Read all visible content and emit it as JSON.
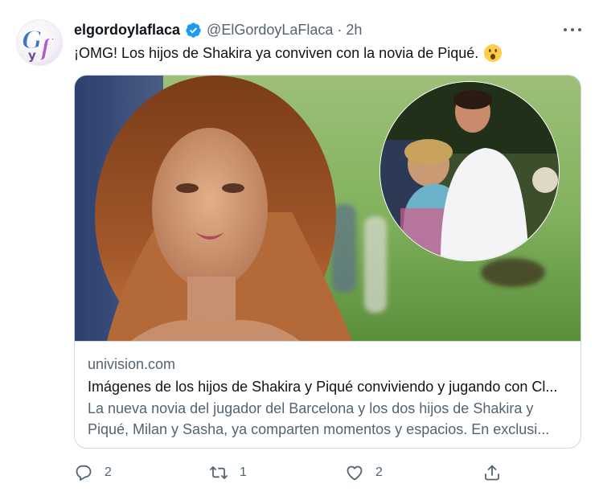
{
  "author": {
    "name": "elgordoylaflaca",
    "handle": "@ElGordoyLaFlaca",
    "time": "2h",
    "avatar_letters": "GyF",
    "verified_color": "#1d9bf0"
  },
  "separator": "·",
  "tweet_text": "¡OMG! Los hijos de Shakira ya conviven con la novia de Piqué.",
  "emoji": "face-with-open-mouth-emoji",
  "link_card": {
    "domain": "univision.com",
    "title": "Imágenes de los hijos de Shakira y Piqué conviviendo y jugando con Cl...",
    "description_line1": "La nueva novia del jugador del Barcelona y los dos hijos de Shakira y",
    "description_line2": "Piqué, Milan y Sasha, ya comparten momentos y espacios. En exclusi..."
  },
  "actions": {
    "replies": "2",
    "retweets": "1",
    "likes": "2"
  },
  "colors": {
    "text": "#0f1419",
    "secondary": "#536471",
    "border": "#cfd9de",
    "brand": "#1d9bf0"
  }
}
